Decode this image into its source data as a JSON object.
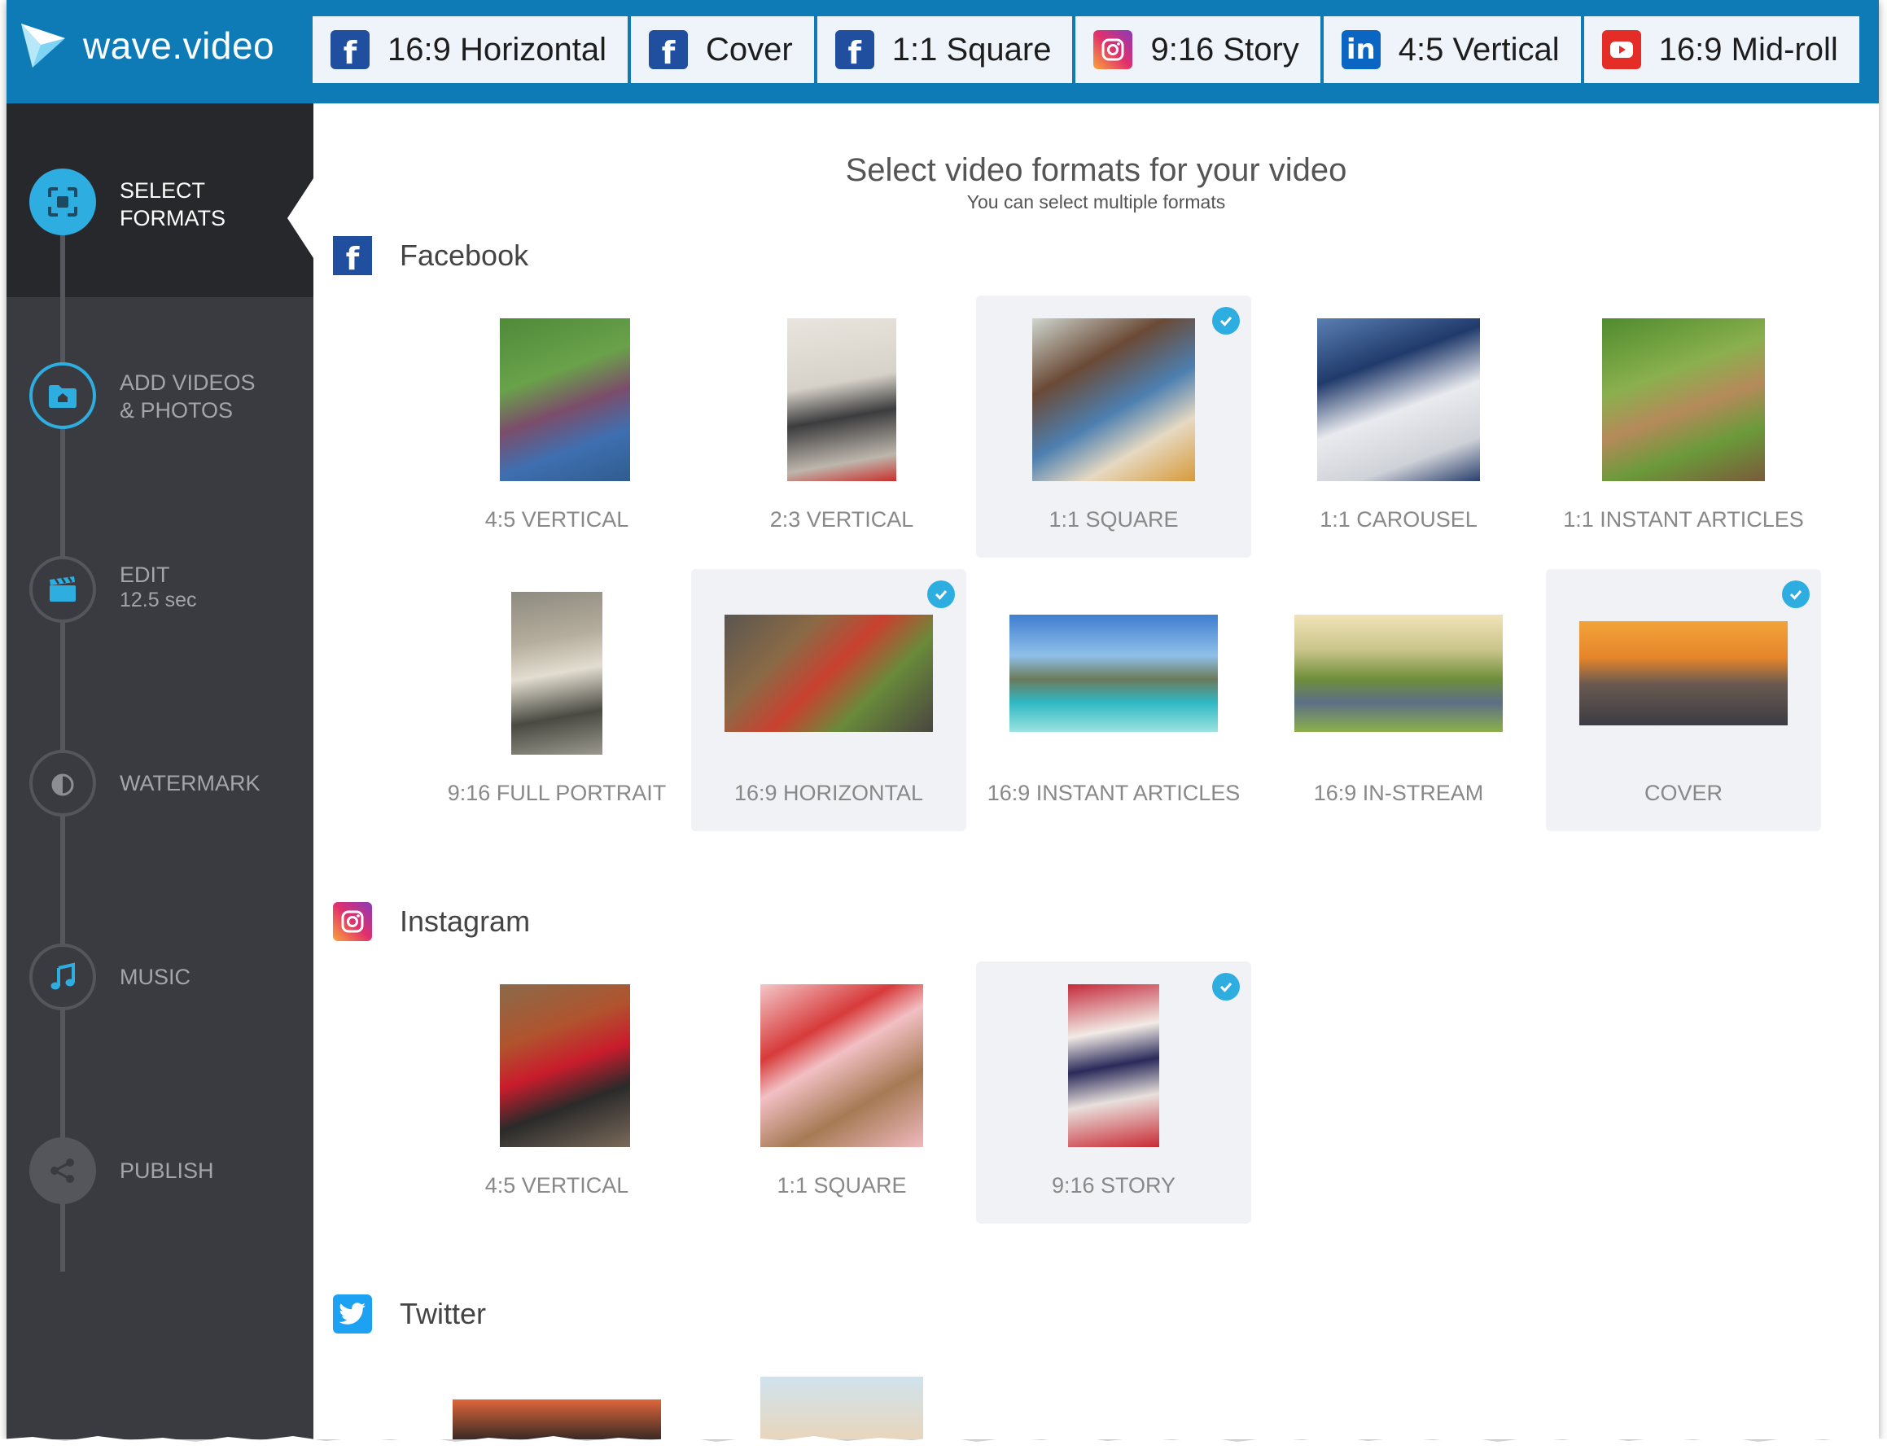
{
  "app": {
    "logo_text": "wave.video"
  },
  "tabs": [
    {
      "label": "16:9 Horizontal",
      "platform": "facebook",
      "icon": "facebook-icon"
    },
    {
      "label": "Cover",
      "platform": "facebook",
      "icon": "facebook-icon"
    },
    {
      "label": "1:1 Square",
      "platform": "facebook",
      "icon": "facebook-icon"
    },
    {
      "label": "9:16 Story",
      "platform": "instagram",
      "icon": "instagram-icon"
    },
    {
      "label": "4:5 Vertical",
      "platform": "linkedin",
      "icon": "linkedin-icon"
    },
    {
      "label": "16:9 Mid-roll",
      "platform": "youtube",
      "icon": "youtube-icon"
    }
  ],
  "sidebar": {
    "steps": [
      {
        "line1": "SELECT",
        "line2": "FORMATS",
        "icon": "select-formats-icon",
        "active": true
      },
      {
        "line1": "ADD VIDEOS",
        "line2": "& PHOTOS",
        "icon": "folder-icon",
        "active": false
      },
      {
        "line1": "EDIT",
        "sub": "12.5 sec",
        "icon": "clapperboard-icon",
        "active": false
      },
      {
        "line1": "WATERMARK",
        "icon": "watermark-icon",
        "active": false
      },
      {
        "line1": "MUSIC",
        "icon": "music-note-icon",
        "active": false
      },
      {
        "line1": "PUBLISH",
        "icon": "share-icon",
        "active": false
      }
    ]
  },
  "main": {
    "headline": "Select video formats for your video",
    "subhead": "You can select multiple formats",
    "sections": {
      "facebook": {
        "title": "Facebook",
        "formats": [
          {
            "label": "4:5 VERTICAL",
            "selected": false
          },
          {
            "label": "2:3 VERTICAL",
            "selected": false
          },
          {
            "label": "1:1 SQUARE",
            "selected": true
          },
          {
            "label": "1:1 CAROUSEL",
            "selected": false
          },
          {
            "label": "1:1 INSTANT ARTICLES",
            "selected": false
          },
          {
            "label": "9:16 FULL PORTRAIT",
            "selected": false
          },
          {
            "label": "16:9 HORIZONTAL",
            "selected": true
          },
          {
            "label": "16:9 INSTANT ARTICLES",
            "selected": false
          },
          {
            "label": "16:9 IN-STREAM",
            "selected": false
          },
          {
            "label": "COVER",
            "selected": true
          }
        ]
      },
      "instagram": {
        "title": "Instagram",
        "formats": [
          {
            "label": "4:5 VERTICAL",
            "selected": false
          },
          {
            "label": "1:1 SQUARE",
            "selected": false
          },
          {
            "label": "9:16 STORY",
            "selected": true
          }
        ]
      },
      "twitter": {
        "title": "Twitter"
      }
    }
  },
  "colors": {
    "topbar": "#0e7bb7",
    "sidebar": "#3a3b40",
    "sidebar_active": "#27282c",
    "accent": "#2eaee0",
    "selected_card": "#f0f2f5"
  }
}
